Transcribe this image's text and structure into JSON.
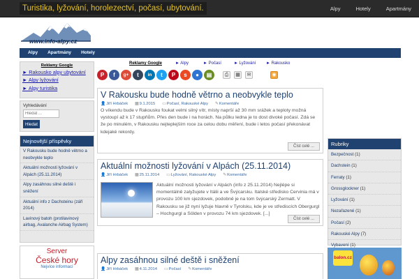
{
  "topbar": {
    "tagline": "Turistika, lyžování, horolezectví, počasí, ubytování.",
    "nav": [
      "Alpy",
      "Hotely",
      "Apartmány"
    ]
  },
  "header": {
    "logo_text": "www.info-alpy.cz"
  },
  "mainnav": [
    "Alpy",
    "Apartmány",
    "Hotely"
  ],
  "sidebar": {
    "ads": {
      "title": "Reklamy Google",
      "links": [
        "► Rakousko alpy ubytování",
        "► Alpy lyžování",
        "► Alpy turistika"
      ]
    },
    "search": {
      "label": "Vyhledávání",
      "placeholder": "Hledat ...",
      "button": "Hledat"
    },
    "recent": {
      "title": "Nejnovější příspěvky",
      "items": [
        "V Rakousku bude hodně větrno a neobvykle teplo",
        "Aktuální možnosti lyžování v Alpách (25.11.2014)",
        "Alpy zasáhnou silné deště i sněžení",
        "Aktuální info z Dachsteinu (září 2014)",
        "Lavinový batoh (protilavinový airbag, Avalanche Airbag System)"
      ]
    },
    "banner": {
      "line1": "Server",
      "line2": "České hory",
      "line3": "Nejvíce informací"
    }
  },
  "share": {
    "labels": [
      "Reklamy Google",
      "Alpy",
      "Počasí",
      "Lyžování",
      "Rakousko"
    ],
    "icons": [
      {
        "name": "pinterest-icon",
        "glyph": "P",
        "color": "#c8232c"
      },
      {
        "name": "facebook-icon",
        "glyph": "f",
        "color": "#3b5998"
      },
      {
        "name": "google-plus-icon",
        "glyph": "g+",
        "color": "#dd4b39"
      },
      {
        "name": "tumblr-icon",
        "glyph": "t",
        "color": "#35465c"
      },
      {
        "name": "linkedin-icon",
        "glyph": "in",
        "color": "#0077b5"
      },
      {
        "name": "twitter-icon",
        "glyph": "t",
        "color": "#1da1f2"
      },
      {
        "name": "pinterest-icon-2",
        "glyph": "P",
        "color": "#bd081c"
      },
      {
        "name": "stumbleupon-icon",
        "glyph": "s",
        "color": "#eb4924"
      },
      {
        "name": "delicious-icon",
        "glyph": "●",
        "color": "#3274d2"
      },
      {
        "name": "print-friendly-icon",
        "glyph": "▤",
        "color": "#6b8e23"
      }
    ],
    "tools": [
      {
        "name": "print-icon",
        "glyph": "⎙"
      },
      {
        "name": "pdf-icon",
        "glyph": "▦"
      },
      {
        "name": "email-icon",
        "glyph": "✉"
      },
      {
        "name": "rss-icon",
        "glyph": "◉"
      }
    ]
  },
  "posts": [
    {
      "title": "V Rakousku bude hodně větrno a neobvykle teplo",
      "author": "Jiří Hrbáček",
      "date": "9.1.2015",
      "categories": "Počasí, Rakouské Alpy",
      "comments": "Komentáře",
      "text": "O víkendu bude v Rakousku foukat velmi silný vítr, místy naprší až 30 mm srážek a teploty možná vystoupí až k 17 stupňům. Přes den bude i na horách. Na půlku ledna je to dost divoké počasí. Zdá se že po minulém, v Rakousku nejteplejším roce za celou dobu měření, bude i letos počasí překonávat kdejaké rekordy.",
      "more": "Číst celé ..."
    },
    {
      "title": "Aktuální možnosti lyžování v Alpách (25.11.2014)",
      "author": "Jiří Hrbáček",
      "date": "25.11.2014",
      "categories": "Lyžování, Rakouské Alpy",
      "comments": "Komentáře",
      "text": "Aktuální možnosti lyžování v Alpách (info z 25.11.2014) Nejlépe si momentálně zalyžujete v Itálii a ve Švýcarsku. Italské středisko Cervinia má v provozu 100 km sjezdovek, podobně je na tom švýcarský Zermatt. V Rakousku se již nyní lyžuje hlavně v Tyrolsku, kde je ve střediscích Obergurgl – Hochgurgl a Sölden v provozu 74 km sjezdovek. [...]",
      "more": "Číst celé ..."
    },
    {
      "title": "Alpy zasáhnou silné deště i sněžení",
      "author": "Jiří Hrbáček",
      "date": "4.11.2014",
      "categories": "Počasí",
      "comments": "Komentáře"
    }
  ],
  "rubriky": {
    "title": "Rubriky",
    "items": [
      {
        "name": "Bezpečnost",
        "count": "(1)"
      },
      {
        "name": "Dachstein",
        "count": "(1)"
      },
      {
        "name": "Ferraty",
        "count": "(1)"
      },
      {
        "name": "Grossglockner",
        "count": "(1)"
      },
      {
        "name": "Lyžování",
        "count": "(1)"
      },
      {
        "name": "Nezařazené",
        "count": "(1)"
      },
      {
        "name": "Počasí",
        "count": "(2)"
      },
      {
        "name": "Rakouské Alpy",
        "count": "(7)"
      },
      {
        "name": "Vybavení",
        "count": "(1)"
      }
    ]
  },
  "right_ad": {
    "badge": "balon.cz"
  },
  "colors": {
    "navy": "#1f4271",
    "tagline": "#e5c229",
    "link": "#1a1aa6"
  }
}
